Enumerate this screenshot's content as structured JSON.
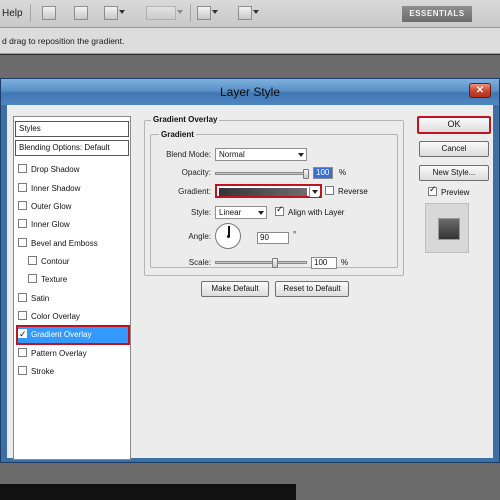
{
  "app": {
    "menu_help": "Help",
    "workspace_button": "ESSENTIALS",
    "options_hint": "d drag to reposition the gradient."
  },
  "dialog": {
    "title": "Layer Style",
    "close_glyph": "✕",
    "styles_header": "Styles",
    "blending_options": "Blending Options: Default",
    "style_items": [
      {
        "label": "Drop Shadow",
        "checked": false
      },
      {
        "label": "Inner Shadow",
        "checked": false
      },
      {
        "label": "Outer Glow",
        "checked": false
      },
      {
        "label": "Inner Glow",
        "checked": false
      },
      {
        "label": "Bevel and Emboss",
        "checked": false
      },
      {
        "label": "Contour",
        "checked": false
      },
      {
        "label": "Texture",
        "checked": false
      },
      {
        "label": "Satin",
        "checked": false
      },
      {
        "label": "Color Overlay",
        "checked": false
      },
      {
        "label": "Gradient Overlay",
        "checked": true,
        "selected": true
      },
      {
        "label": "Pattern Overlay",
        "checked": false
      },
      {
        "label": "Stroke",
        "checked": false
      }
    ],
    "section_title": "Gradient Overlay",
    "group_title": "Gradient",
    "blend_mode_label": "Blend Mode:",
    "blend_mode_value": "Normal",
    "opacity_label": "Opacity:",
    "opacity_value": "100",
    "opacity_unit": "%",
    "gradient_label": "Gradient:",
    "reverse_label": "Reverse",
    "style_label": "Style:",
    "style_value": "Linear",
    "align_label": "Align with Layer",
    "angle_label": "Angle:",
    "angle_value": "90",
    "angle_unit": "°",
    "scale_label": "Scale:",
    "scale_value": "100",
    "scale_unit": "%",
    "make_default": "Make Default",
    "reset_default": "Reset to Default",
    "ok": "OK",
    "cancel": "Cancel",
    "new_style": "New Style...",
    "preview_label": "Preview"
  },
  "colors": {
    "selection_blue": "#3399ff",
    "highlight_red": "#c1121f",
    "title_blue": "#5a90c8"
  }
}
